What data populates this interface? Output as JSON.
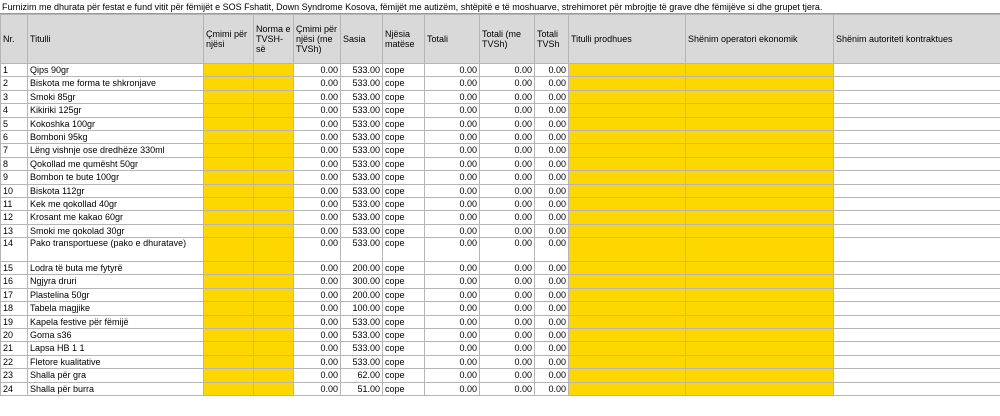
{
  "sheet_title": "Furnizim me dhurata për festat e fund vitit për fëmijët e SOS Fshatit, Down Syndrome Kosova, fëmijët me autizëm, shtëpitë e të moshuarve, strehimoret për mbrojtje të grave dhe fëmijëve si dhe grupet  tjera.",
  "columns": {
    "nr": "Nr.",
    "titulli": "Titulli",
    "cmimi": "Çmimi për njësi",
    "norma": "Norma e TVSH-së",
    "cmimi_me": "Çmimi për njësi (me TVSh)",
    "sasia": "Sasia",
    "njesia": "Njësia matëse",
    "totali": "Totali",
    "totali_me": "Totali (me TVSh)",
    "totali_tvsh": "Totali TVSh",
    "prodhues": "Titulli prodhues",
    "operator": "Shënim operatori ekonomik",
    "autoritet": "Shënim autoriteti kontraktues"
  },
  "rows": [
    {
      "nr": "1",
      "titulli": "Qips 90gr",
      "cmimi_me": "0.00",
      "sasia": "533.00",
      "njesia": "cope",
      "totali": "0.00",
      "totali_me": "0.00",
      "totali_tvsh": "0.00"
    },
    {
      "nr": "2",
      "titulli": "Biskota me forma te shkronjave",
      "cmimi_me": "0.00",
      "sasia": "533.00",
      "njesia": "cope",
      "totali": "0.00",
      "totali_me": "0.00",
      "totali_tvsh": "0.00"
    },
    {
      "nr": "3",
      "titulli": "Smoki 85gr",
      "cmimi_me": "0.00",
      "sasia": "533.00",
      "njesia": "cope",
      "totali": "0.00",
      "totali_me": "0.00",
      "totali_tvsh": "0.00"
    },
    {
      "nr": "4",
      "titulli": "Kikiriki 125gr",
      "cmimi_me": "0.00",
      "sasia": "533.00",
      "njesia": "cope",
      "totali": "0.00",
      "totali_me": "0.00",
      "totali_tvsh": "0.00"
    },
    {
      "nr": "5",
      "titulli": "Kokoshka 100gr",
      "cmimi_me": "0.00",
      "sasia": "533.00",
      "njesia": "cope",
      "totali": "0.00",
      "totali_me": "0.00",
      "totali_tvsh": "0.00"
    },
    {
      "nr": "6",
      "titulli": "Bomboni 95kg",
      "cmimi_me": "0.00",
      "sasia": "533.00",
      "njesia": "cope",
      "totali": "0.00",
      "totali_me": "0.00",
      "totali_tvsh": "0.00"
    },
    {
      "nr": "7",
      "titulli": "Lëng vishnje ose dredhëze 330ml",
      "cmimi_me": "0.00",
      "sasia": "533.00",
      "njesia": "cope",
      "totali": "0.00",
      "totali_me": "0.00",
      "totali_tvsh": "0.00"
    },
    {
      "nr": "8",
      "titulli": "Qokollad me qumësht 50gr",
      "cmimi_me": "0.00",
      "sasia": "533.00",
      "njesia": "cope",
      "totali": "0.00",
      "totali_me": "0.00",
      "totali_tvsh": "0.00"
    },
    {
      "nr": "9",
      "titulli": "Bombon te bute 100gr",
      "cmimi_me": "0.00",
      "sasia": "533.00",
      "njesia": "cope",
      "totali": "0.00",
      "totali_me": "0.00",
      "totali_tvsh": "0.00"
    },
    {
      "nr": "10",
      "titulli": "Biskota 112gr",
      "cmimi_me": "0.00",
      "sasia": "533.00",
      "njesia": "cope",
      "totali": "0.00",
      "totali_me": "0.00",
      "totali_tvsh": "0.00"
    },
    {
      "nr": "11",
      "titulli": "Kek me qokollad 40gr",
      "cmimi_me": "0.00",
      "sasia": "533.00",
      "njesia": "cope",
      "totali": "0.00",
      "totali_me": "0.00",
      "totali_tvsh": "0.00"
    },
    {
      "nr": "12",
      "titulli": "Krosant me kakao 60gr",
      "cmimi_me": "0.00",
      "sasia": "533.00",
      "njesia": "cope",
      "totali": "0.00",
      "totali_me": "0.00",
      "totali_tvsh": "0.00"
    },
    {
      "nr": "13",
      "titulli": "Smoki me qokolad 30gr",
      "cmimi_me": "0.00",
      "sasia": "533.00",
      "njesia": "cope",
      "totali": "0.00",
      "totali_me": "0.00",
      "totali_tvsh": "0.00"
    },
    {
      "nr": "14",
      "titulli": "Pako transportuese (pako e dhuratave)",
      "cmimi_me": "0.00",
      "sasia": "533.00",
      "njesia": "cope",
      "totali": "0.00",
      "totali_me": "0.00",
      "totali_tvsh": "0.00",
      "tall": true
    },
    {
      "nr": "15",
      "titulli": "Lodra të buta me fytyrë",
      "cmimi_me": "0.00",
      "sasia": "200.00",
      "njesia": "cope",
      "totali": "0.00",
      "totali_me": "0.00",
      "totali_tvsh": "0.00"
    },
    {
      "nr": "16",
      "titulli": "Ngjyra druri",
      "cmimi_me": "0.00",
      "sasia": "300.00",
      "njesia": "cope",
      "totali": "0.00",
      "totali_me": "0.00",
      "totali_tvsh": "0.00"
    },
    {
      "nr": "17",
      "titulli": "Plastelina 50gr",
      "cmimi_me": "0.00",
      "sasia": "200.00",
      "njesia": "cope",
      "totali": "0.00",
      "totali_me": "0.00",
      "totali_tvsh": "0.00"
    },
    {
      "nr": "18",
      "titulli": "Tabela magjike",
      "cmimi_me": "0.00",
      "sasia": "100.00",
      "njesia": "cope",
      "totali": "0.00",
      "totali_me": "0.00",
      "totali_tvsh": "0.00"
    },
    {
      "nr": "19",
      "titulli": "Kapela festive për fëmijë",
      "cmimi_me": "0.00",
      "sasia": "533.00",
      "njesia": "cope",
      "totali": "0.00",
      "totali_me": "0.00",
      "totali_tvsh": "0.00"
    },
    {
      "nr": "20",
      "titulli": "Goma s36",
      "cmimi_me": "0.00",
      "sasia": "533.00",
      "njesia": "cope",
      "totali": "0.00",
      "totali_me": "0.00",
      "totali_tvsh": "0.00"
    },
    {
      "nr": "21",
      "titulli": "Lapsa HB 1  1",
      "cmimi_me": "0.00",
      "sasia": "533.00",
      "njesia": "cope",
      "totali": "0.00",
      "totali_me": "0.00",
      "totali_tvsh": "0.00"
    },
    {
      "nr": "22",
      "titulli": "Fletore kualitative",
      "cmimi_me": "0.00",
      "sasia": "533.00",
      "njesia": "cope",
      "totali": "0.00",
      "totali_me": "0.00",
      "totali_tvsh": "0.00"
    },
    {
      "nr": "23",
      "titulli": "Shalla për gra",
      "cmimi_me": "0.00",
      "sasia": "62.00",
      "njesia": "cope",
      "totali": "0.00",
      "totali_me": "0.00",
      "totali_tvsh": "0.00"
    },
    {
      "nr": "24",
      "titulli": "Shalla për burra",
      "cmimi_me": "0.00",
      "sasia": "51.00",
      "njesia": "cope",
      "totali": "0.00",
      "totali_me": "0.00",
      "totali_tvsh": "0.00"
    }
  ],
  "colors": {
    "input_highlight": "#ffd700",
    "header_bg": "#d9d9d9",
    "grid": "#b5b5b5"
  }
}
